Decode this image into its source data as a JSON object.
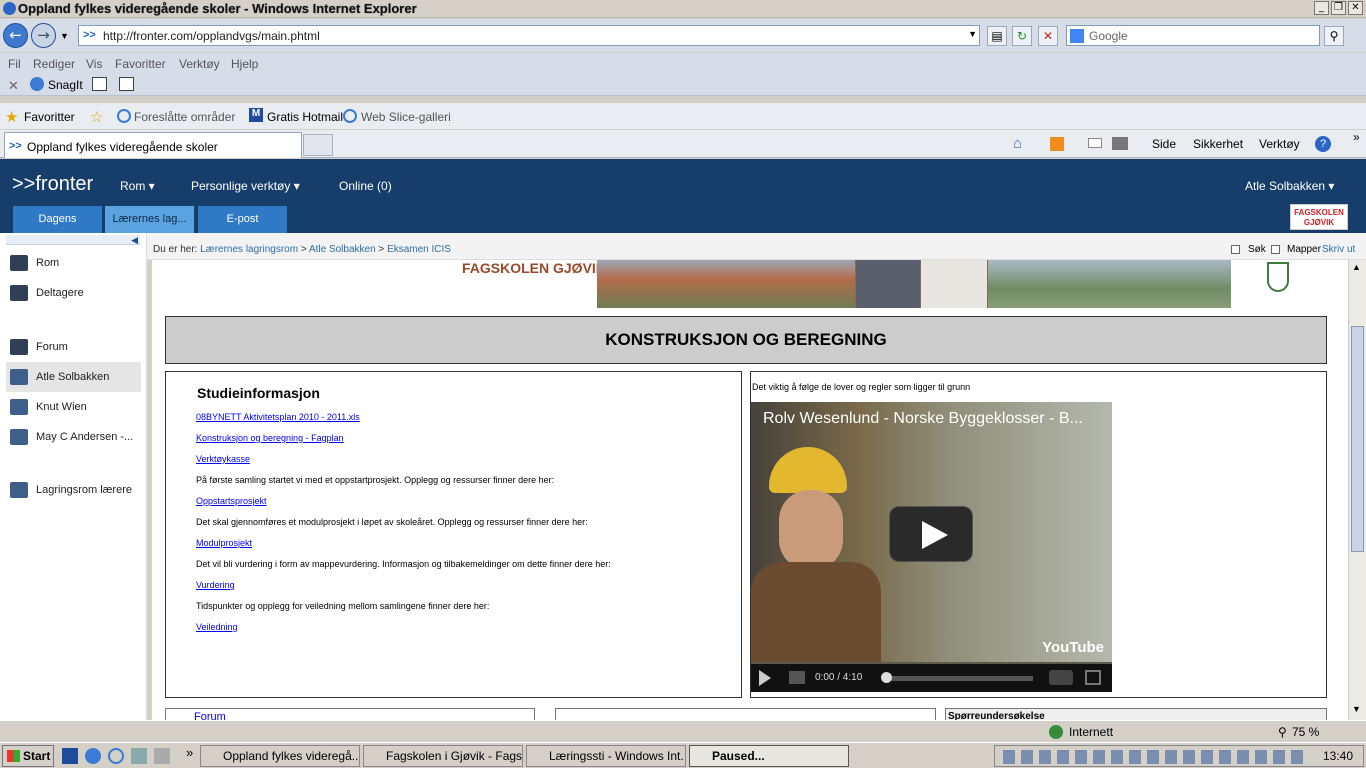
{
  "window": {
    "title": "Oppland fylkes videregående skoler - Windows Internet Explorer"
  },
  "address": {
    "url": "http://fronter.com/opplandvgs/main.phtml",
    "search_placeholder": "Google"
  },
  "menu": [
    "Fil",
    "Rediger",
    "Vis",
    "Favoritter",
    "Verktøy",
    "Hjelp"
  ],
  "linkbar": {
    "snagit": "SnagIt"
  },
  "favorites": {
    "label": "Favoritter",
    "suggested": "Foreslåtte områder",
    "hotmail": "Gratis Hotmail",
    "webslice": "Web Slice-galleri"
  },
  "tabs": {
    "active": "Oppland fylkes videregående skoler"
  },
  "commandbar": {
    "side": "Side",
    "security": "Sikkerhet",
    "tools": "Verktøy"
  },
  "fronter": {
    "logo": ">>fronter",
    "nav": [
      "Rom",
      "Personlige verktøy",
      "Online (0)"
    ],
    "user": "Atle Solbakken",
    "tabs": [
      "Dagens",
      "Lærernes lag...",
      "E-post"
    ],
    "fagskolen_logo": "FAGSKOLEN GJØVIK"
  },
  "breadcrumb": {
    "prefix": "Du er her:",
    "items": [
      "Lærernes lagringsrom",
      "Atle Solbakken",
      "Eksamen ICIS"
    ],
    "search": "Søk",
    "folders": "Mapper",
    "print": "Skriv ut"
  },
  "sidebar": {
    "items": [
      {
        "label": "Rom"
      },
      {
        "label": "Deltagere"
      },
      {
        "label": "Forum"
      },
      {
        "label": "Atle Solbakken"
      },
      {
        "label": "Knut Wien"
      },
      {
        "label": "May C Andersen -..."
      },
      {
        "label": "Lagringsrom lærere"
      }
    ]
  },
  "page": {
    "banner_logo": "FAGSKOLEN GJØVIK",
    "title": "KONSTRUKSJON OG BEREGNING",
    "left": {
      "heading": "Studieinformasjon",
      "lines": [
        {
          "text": "08BYNETT Aktivitetsplan 2010 - 2011.xls",
          "link": true
        },
        {
          "text": "Konstruksjon og beregning - Fagplan",
          "link": true
        },
        {
          "text": "Verktøykasse",
          "link": true
        },
        {
          "text": " På første samling startet vi med et oppstartprosjekt. Opplegg og ressurser finner dere her:",
          "link": false
        },
        {
          "text": "Oppstartsprosjekt",
          "link": true
        },
        {
          "text": " Det skal gjennomføres et modulprosjekt i løpet av skoleåret. Opplegg og ressurser finner dere her:",
          "link": false
        },
        {
          "text": "Modulprosjekt",
          "link": true
        },
        {
          "text": "Det vil bli vurdering i form av mappevurdering. Informasjon og tilbakemeldinger om dette finner dere her:",
          "link": false
        },
        {
          "text": "Vurdering",
          "link": true
        },
        {
          "text": "Tidspunkter og opplegg for veiledning mellom samlingene finner dere her:",
          "link": false
        },
        {
          "text": "Veiledning",
          "link": true
        }
      ]
    },
    "right": {
      "intro": "Det viktig å følge de lover og regler som ligger til grunn",
      "video_title": "Rolv Wesenlund - Norske Byggeklosser - B...",
      "video_time": "0:00 / 4:10",
      "video_brand": "YouTube",
      "video_progress": 0
    },
    "bottom": {
      "forum": "Forum",
      "survey": "Spørreundersøkelse"
    }
  },
  "statusbar": {
    "zone": "Internett",
    "zoom": "75 %"
  },
  "taskbar": {
    "start": "Start",
    "tasks": [
      "Oppland fylkes videregå...",
      "Fagskolen i Gjøvik - Fags...",
      "Læringssti - Windows Int...",
      "Paused..."
    ],
    "clock": "13:40"
  }
}
